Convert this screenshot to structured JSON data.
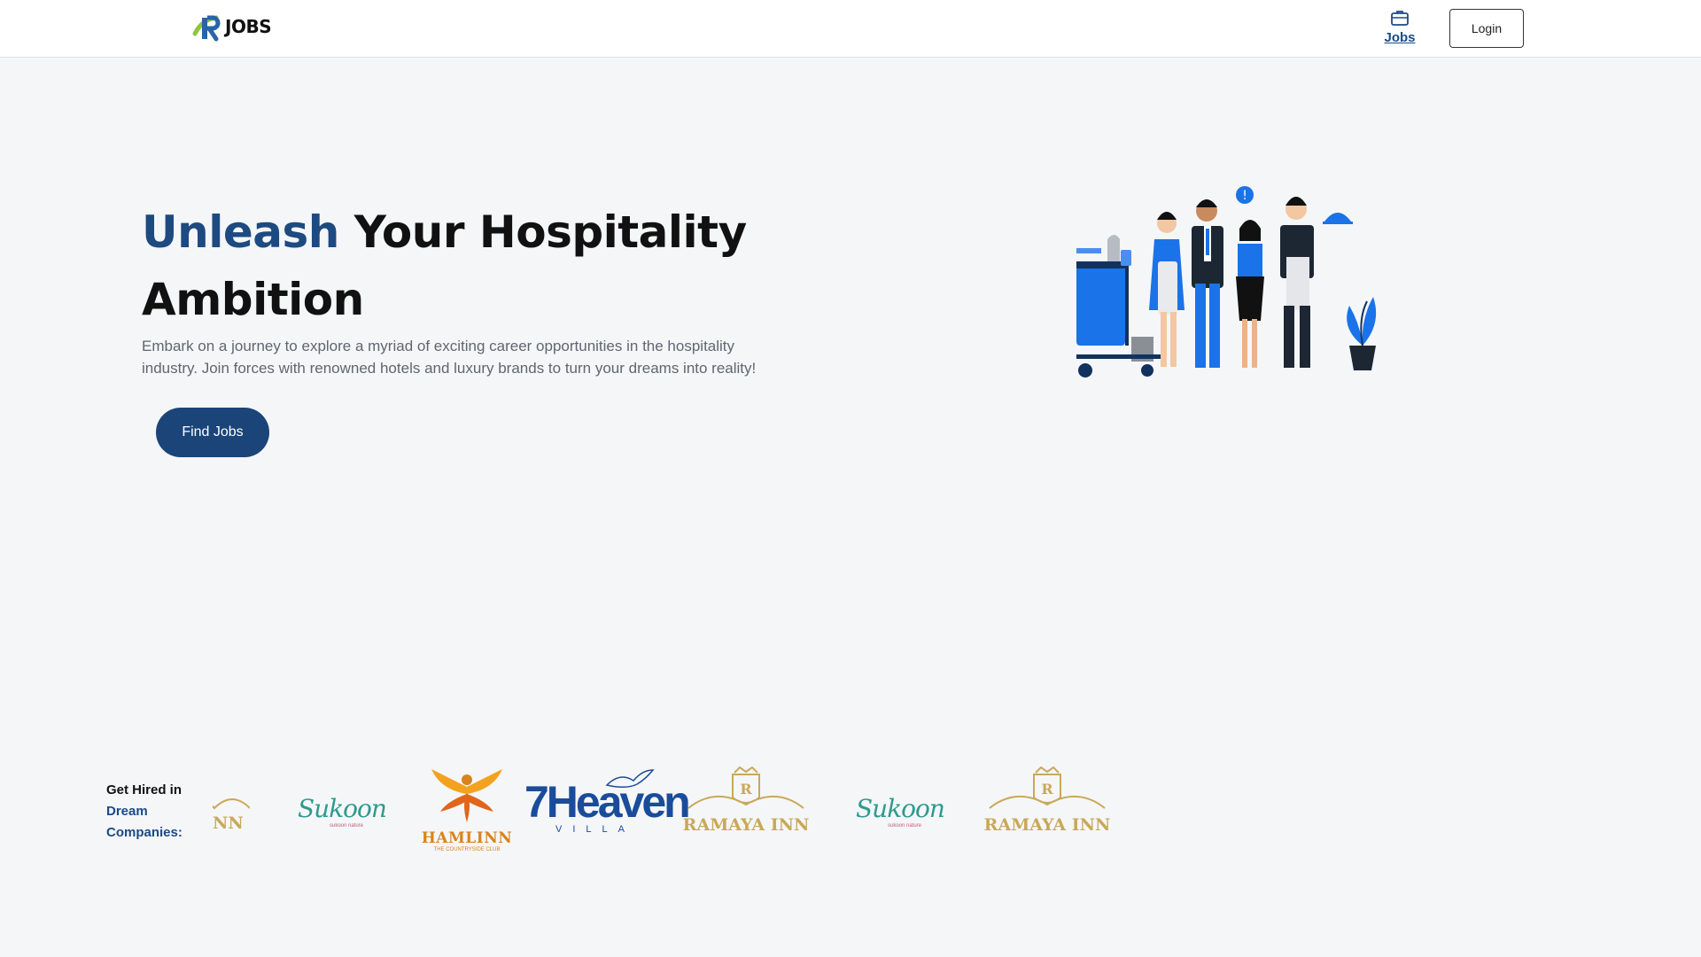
{
  "header": {
    "logo_text": "JOBS",
    "nav_jobs_label": "Jobs",
    "login_label": "Login",
    "icons": {
      "jobs": "briefcase-icon",
      "logo": "r-logo-icon"
    }
  },
  "hero": {
    "title_accent": "Unleash",
    "title_rest": " Your Hospitality Ambition",
    "subtitle": "Embark on a journey to explore a myriad of exciting career opportunities in the hospitality industry. Join forces with renowned hotels and luxury brands to turn your dreams into reality!",
    "cta_label": "Find Jobs"
  },
  "companies": {
    "label_prefix": "Get Hired in",
    "label_accent": "Dream Companies:",
    "logos": [
      {
        "name": "NN"
      },
      {
        "name": "Sukoon",
        "tagline": "sukoon nature"
      },
      {
        "name": "HAMLINN",
        "tagline": "THE COUNTRYSIDE CLUB"
      },
      {
        "name": "7Heaven",
        "tagline": "VILLA"
      },
      {
        "name": "RAMAYA INN"
      },
      {
        "name": "Sukoon",
        "tagline": "sukoon nature"
      },
      {
        "name": "RAMAYA INN"
      }
    ]
  },
  "colors": {
    "accent_blue": "#1d4a80",
    "button_blue": "#1b4479",
    "background": "#f5f6f8"
  }
}
